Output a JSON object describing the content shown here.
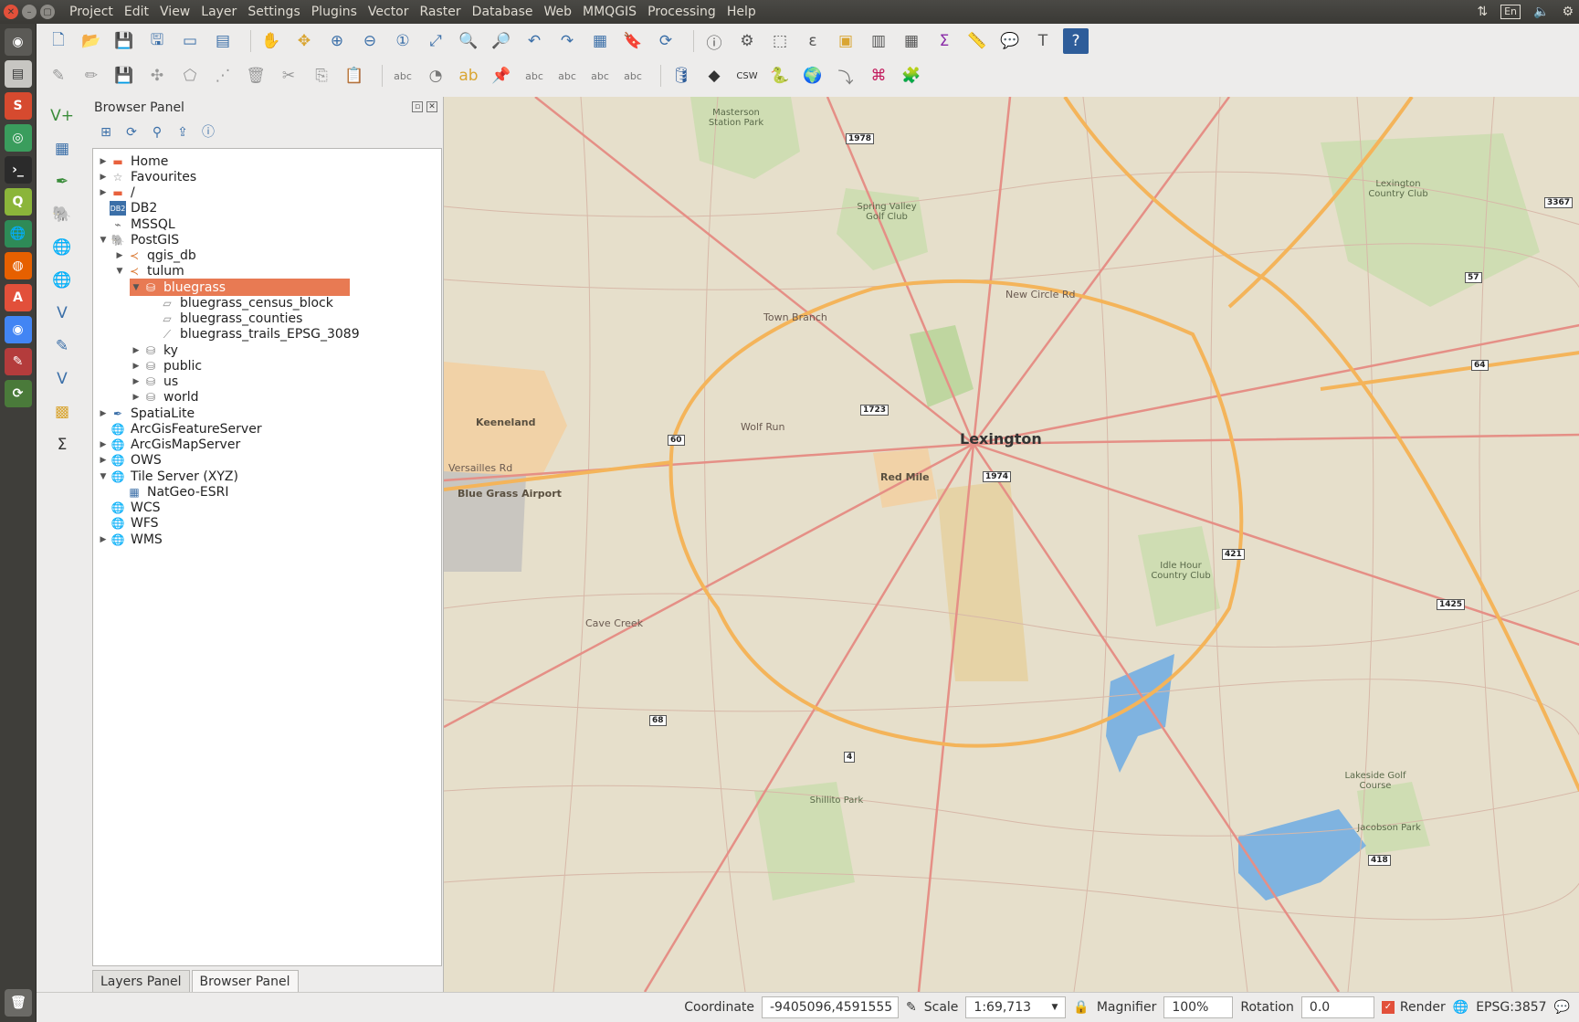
{
  "menubar": {
    "items": [
      "Project",
      "Edit",
      "View",
      "Layer",
      "Settings",
      "Plugins",
      "Vector",
      "Raster",
      "Database",
      "Web",
      "MMQGIS",
      "Processing",
      "Help"
    ],
    "lang": "En"
  },
  "browser_panel": {
    "title": "Browser Panel",
    "tree": [
      {
        "label": "Home",
        "indent": 0,
        "arrow": "▶",
        "icon": "folder-icon"
      },
      {
        "label": "Favourites",
        "indent": 0,
        "arrow": "▶",
        "icon": "star-icon"
      },
      {
        "label": "/",
        "indent": 0,
        "arrow": "▶",
        "icon": "folder-icon"
      },
      {
        "label": "DB2",
        "indent": 0,
        "arrow": "",
        "icon": "db2-icon"
      },
      {
        "label": "MSSQL",
        "indent": 0,
        "arrow": "",
        "icon": "mssql-icon"
      },
      {
        "label": "PostGIS",
        "indent": 0,
        "arrow": "▼",
        "icon": "postgis-icon"
      },
      {
        "label": "qgis_db",
        "indent": 1,
        "arrow": "▶",
        "icon": "connection-icon"
      },
      {
        "label": "tulum",
        "indent": 1,
        "arrow": "▼",
        "icon": "connection-icon"
      },
      {
        "label": "bluegrass",
        "indent": 2,
        "arrow": "▼",
        "icon": "schema-icon",
        "selected": true
      },
      {
        "label": "bluegrass_census_block",
        "indent": 3,
        "arrow": "",
        "icon": "polygon-layer-icon"
      },
      {
        "label": "bluegrass_counties",
        "indent": 3,
        "arrow": "",
        "icon": "polygon-layer-icon"
      },
      {
        "label": "bluegrass_trails_EPSG_3089",
        "indent": 3,
        "arrow": "",
        "icon": "line-layer-icon"
      },
      {
        "label": "ky",
        "indent": 2,
        "arrow": "▶",
        "icon": "schema-icon"
      },
      {
        "label": "public",
        "indent": 2,
        "arrow": "▶",
        "icon": "schema-icon"
      },
      {
        "label": "us",
        "indent": 2,
        "arrow": "▶",
        "icon": "schema-icon"
      },
      {
        "label": "world",
        "indent": 2,
        "arrow": "▶",
        "icon": "schema-icon"
      },
      {
        "label": "SpatiaLite",
        "indent": 0,
        "arrow": "▶",
        "icon": "spatialite-icon"
      },
      {
        "label": "ArcGisFeatureServer",
        "indent": 0,
        "arrow": "",
        "icon": "globe-icon"
      },
      {
        "label": "ArcGisMapServer",
        "indent": 0,
        "arrow": "▶",
        "icon": "globe-icon"
      },
      {
        "label": "OWS",
        "indent": 0,
        "arrow": "▶",
        "icon": "globe-icon"
      },
      {
        "label": "Tile Server (XYZ)",
        "indent": 0,
        "arrow": "▼",
        "icon": "globe-icon"
      },
      {
        "label": "NatGeo-ESRI",
        "indent": 1,
        "arrow": "",
        "icon": "tile-icon"
      },
      {
        "label": "WCS",
        "indent": 0,
        "arrow": "",
        "icon": "globe-icon"
      },
      {
        "label": "WFS",
        "indent": 0,
        "arrow": "",
        "icon": "globe-icon"
      },
      {
        "label": "WMS",
        "indent": 0,
        "arrow": "▶",
        "icon": "globe-icon"
      }
    ],
    "tabs": [
      "Layers Panel",
      "Browser Panel"
    ]
  },
  "map": {
    "labels": [
      {
        "text": "Lexington",
        "size": "big"
      },
      {
        "text": "Keeneland",
        "size": "area"
      },
      {
        "text": "Red Mile",
        "size": "area"
      },
      {
        "text": "Blue Grass Airport",
        "size": "area"
      },
      {
        "text": "Masterson Station Park",
        "size": "park"
      },
      {
        "text": "Spring Valley Golf Club",
        "size": "park"
      },
      {
        "text": "Lexington Country Club",
        "size": "park"
      },
      {
        "text": "Idle Hour Country Club",
        "size": "park"
      },
      {
        "text": "Shillito Park",
        "size": "park"
      },
      {
        "text": "Lakeside Golf Course",
        "size": "park"
      },
      {
        "text": "Jacobson Park",
        "size": "park"
      },
      {
        "text": "New Circle Rd",
        "size": "road"
      },
      {
        "text": "Versailles Rd",
        "size": "road"
      },
      {
        "text": "Cave Creek",
        "size": "road"
      },
      {
        "text": "Wolf Run",
        "size": "road"
      },
      {
        "text": "Town Branch",
        "size": "road"
      }
    ],
    "shields": [
      "1978",
      "3367",
      "57",
      "64",
      "1723",
      "60",
      "1974",
      "421",
      "1425",
      "68",
      "4",
      "418"
    ]
  },
  "statusbar": {
    "coordinate_label": "Coordinate",
    "coordinate_value": "-9405096,4591555",
    "scale_label": "Scale",
    "scale_value": "1:69,713",
    "magnifier_label": "Magnifier",
    "magnifier_value": "100%",
    "rotation_label": "Rotation",
    "rotation_value": "0.0",
    "render_label": "Render",
    "crs_label": "EPSG:3857"
  }
}
